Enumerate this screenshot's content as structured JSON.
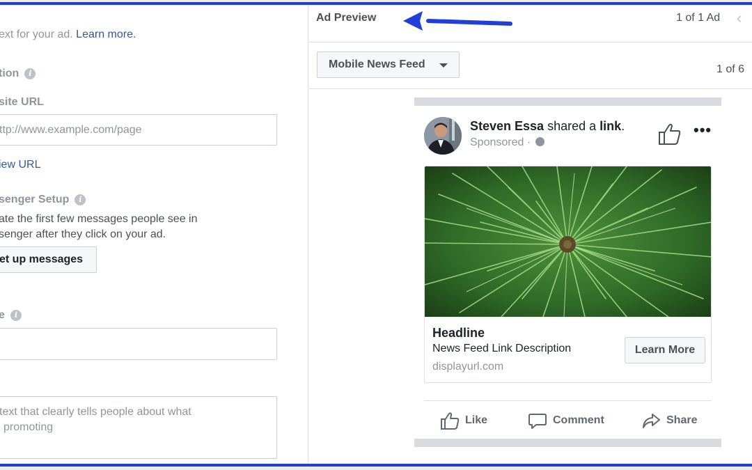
{
  "left_panel": {
    "intro_text": "ext for your ad.",
    "intro_link": "Learn more.",
    "destination_label": "tion",
    "website_url_label": "site URL",
    "website_url_placeholder": "ttp://www.example.com/page",
    "preview_url_link": "iew URL",
    "messenger_label": "senger Setup",
    "messenger_line1": "ate the first few messages people see in",
    "messenger_line2": "senger after they click on your ad.",
    "setup_button": "et up messages",
    "display_label": "e",
    "text_placeholder_line1": "text that clearly tells people about what",
    "text_placeholder_line2": "promoting"
  },
  "right_panel": {
    "title": "Ad Preview",
    "ad_count": "1 of 1 Ad",
    "placement_select": "Mobile News Feed",
    "page_count": "1 of 6"
  },
  "post": {
    "poster_name": "Steven Essa",
    "shared_text": " shared a ",
    "shared_link_word": "link",
    "shared_period": ".",
    "sponsored": "Sponsored",
    "headline": "Headline",
    "description": "News Feed Link Description",
    "display_url": "displayurl.com",
    "cta_label": "Learn More",
    "actions": [
      "Like",
      "Comment",
      "Share"
    ]
  },
  "icons": {
    "info": "info-icon",
    "prev": "chevron-left-icon",
    "caret": "caret-down-icon",
    "like_page": "thumbs-up-icon",
    "more": "more-dots-icon",
    "globe": "globe-icon",
    "like": "like-icon",
    "comment": "comment-icon",
    "share": "share-icon",
    "annotation": "arrow-annotation"
  },
  "colors": {
    "accent_blue": "#1f3fd8",
    "link_blue": "#365899",
    "muted_text": "#90949c"
  }
}
